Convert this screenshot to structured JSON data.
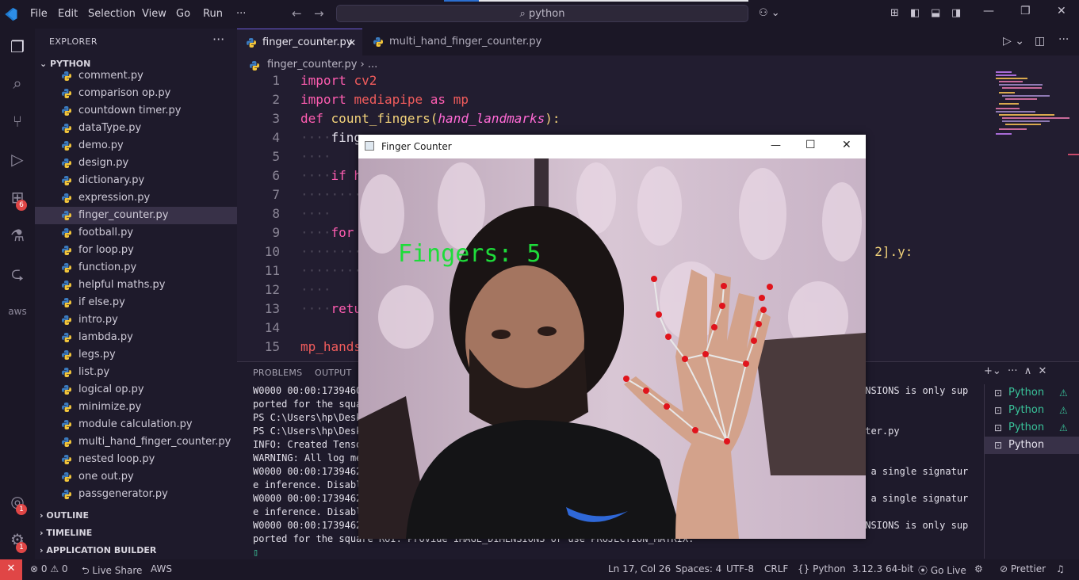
{
  "menu": {
    "file": "File",
    "edit": "Edit",
    "selection": "Selection",
    "view": "View",
    "go": "Go",
    "run": "Run",
    "more": "···"
  },
  "search": {
    "text": "⌕ python"
  },
  "explorer": {
    "title": "EXPLORER",
    "more": "···",
    "folder": "⌄ PYTHON",
    "files": [
      {
        "name": "comment.py"
      },
      {
        "name": "comparison op.py"
      },
      {
        "name": "countdown timer.py"
      },
      {
        "name": "dataType.py"
      },
      {
        "name": "demo.py"
      },
      {
        "name": "design.py"
      },
      {
        "name": "dictionary.py"
      },
      {
        "name": "expression.py"
      },
      {
        "name": "finger_counter.py",
        "selected": true
      },
      {
        "name": "football.py"
      },
      {
        "name": "for loop.py"
      },
      {
        "name": "function.py"
      },
      {
        "name": "helpful maths.py"
      },
      {
        "name": "if else.py"
      },
      {
        "name": "intro.py"
      },
      {
        "name": "lambda.py"
      },
      {
        "name": "legs.py"
      },
      {
        "name": "list.py"
      },
      {
        "name": "logical op.py"
      },
      {
        "name": "minimize.py"
      },
      {
        "name": "module calculation.py"
      },
      {
        "name": "multi_hand_finger_counter.py"
      },
      {
        "name": "nested loop.py"
      },
      {
        "name": "one out.py"
      },
      {
        "name": "passgenerator.py"
      }
    ],
    "sections": {
      "outline": "› OUTLINE",
      "timeline": "› TIMELINE",
      "app_builder": "› APPLICATION BUILDER"
    }
  },
  "activity_badges": {
    "extensions": "6",
    "accounts": "1",
    "settings": "1"
  },
  "tabs": [
    {
      "label": "finger_counter.py",
      "active": true,
      "close": "✕"
    },
    {
      "label": "multi_hand_finger_counter.py",
      "active": false
    }
  ],
  "breadcrumb": "finger_counter.py › ...",
  "code": {
    "line_numbers": [
      "1",
      "2",
      "3",
      "4",
      "5",
      "6",
      "7",
      "8",
      "9",
      "10",
      "11",
      "12",
      "13",
      "14",
      "15"
    ],
    "l1_kw": "import",
    "l1_mod": "cv2",
    "l2_kw": "import",
    "l2_mod": "mediapipe",
    "l2_as": "as",
    "l2_alias": "mp",
    "l3_kw": "def",
    "l3_fn": "count_fingers",
    "l3_p1": "(",
    "l3_param": "hand_landmarks",
    "l3_p2": "):",
    "l4": "fing",
    "l6": "if h",
    "l9": "for",
    "l10_right": "- 2].y:",
    "l13": "retu",
    "l15": "mp_hands",
    "ws4": "····",
    "ws8": "········"
  },
  "panel": {
    "tabs": {
      "problems": "PROBLEMS",
      "output": "OUTPUT"
    },
    "terminal_left": [
      "W0000 00:00:1739460",
      "ported for the squa",
      "PS C:\\Users\\hp\\Desk",
      "PS C:\\Users\\hp\\Desk",
      "INFO: Created Tenso",
      "WARNING: All log me",
      "W0000 00:00:1739462",
      "e inference. Disabl",
      "W0000 00:00:1739462",
      "e inference. Disabl",
      "W0000 00:00:1739462",
      "ported for the square ROI. Provide IMAGE_DIMENSIONS or use PROJECTION_MATRIX."
    ],
    "terminal_right": [
      "ENSIONS is only sup",
      "",
      "",
      "nter.py",
      "",
      "",
      "n a single signatur",
      "",
      "n a single signatur",
      "",
      "ENSIONS is only sup",
      ""
    ],
    "cursor": "▯",
    "terminal_list": [
      {
        "label": "Python",
        "warn": true
      },
      {
        "label": "Python",
        "warn": true
      },
      {
        "label": "Python",
        "warn": true
      },
      {
        "label": "Python",
        "warn": false,
        "selected": true
      }
    ],
    "actions": "+⌄  ···  ∧  ✕"
  },
  "status": {
    "remote": "✕",
    "problems": "⊗ 0 ⚠ 0",
    "liveshare": "⮌ Live Share",
    "aws": "AWS",
    "position": "Ln 17, Col 26",
    "spaces": "Spaces: 4",
    "encoding": "UTF-8",
    "eol": "CRLF",
    "language": "{} Python",
    "interpreter": "3.12.3 64-bit",
    "golive": "⦿ Go Live",
    "prettier": "⊘ Prettier",
    "bell": "🔔"
  },
  "finger_window": {
    "title": "Finger Counter",
    "overlay": "Fingers: 5",
    "minimize": "—",
    "maximize": "☐",
    "close": "✕"
  },
  "colors": {
    "accent_green": "#1edc3a",
    "landmark": "#e0141c",
    "terminal_green": "#39c39a"
  }
}
